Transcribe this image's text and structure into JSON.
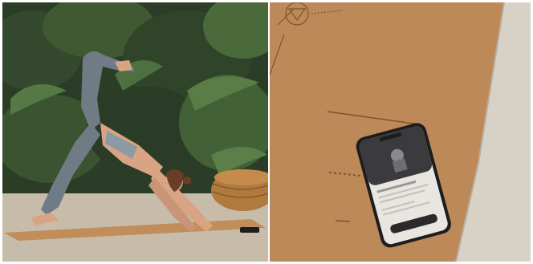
{
  "scene": {
    "left_panel": {
      "description_id": "yoga-downward-dog-split-photo",
      "icons": [
        "plant-foliage",
        "cork-yoga-mat",
        "smartphone",
        "rattan-pouf"
      ]
    },
    "right_panel": {
      "description_id": "cork-mat-with-phone-photo",
      "icons": [
        "triangle-logo",
        "smartphone-app-screen",
        "fabric-towel"
      ]
    },
    "colors": {
      "foliage_dark": "#23331f",
      "foliage_mid": "#3f5a33",
      "floor": "#c7bca9",
      "cork": "#c08d5b",
      "cork_dark": "#9e6c3f",
      "leggings": "#6f7c86",
      "skin": "#d8a484",
      "towel": "#d8d2c6",
      "phone_body": "#1d1d1f"
    }
  }
}
